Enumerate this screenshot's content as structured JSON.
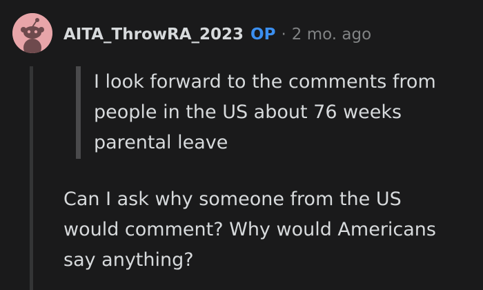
{
  "comment": {
    "username": "AITA_ThrowRA_2023",
    "badge": "OP",
    "separator": "·",
    "timestamp": "2 mo. ago",
    "avatar_icon": "snoo-avatar-icon",
    "quote_lines": [
      "I look forward to the comments from",
      "people in the US about 76 weeks",
      "parental leave"
    ],
    "body_lines": [
      "Can I ask why someone from the US",
      "would comment? Why would Americans",
      "say anything?"
    ]
  },
  "colors": {
    "background": "#1a1a1b",
    "text": "#d7dadc",
    "op_badge": "#3b8ff0",
    "meta": "#818384",
    "avatar_bg": "#e8a5a9"
  }
}
